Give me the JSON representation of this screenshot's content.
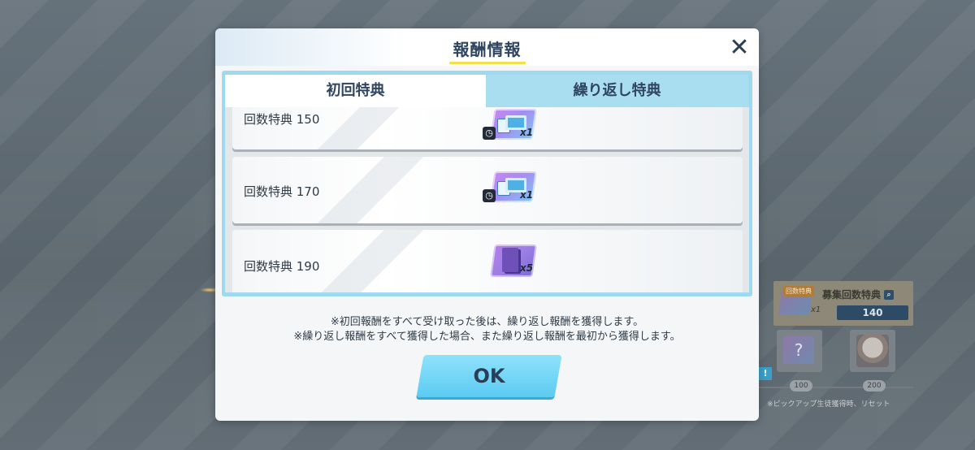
{
  "background": {
    "panel_tag": "回数特典",
    "panel_title": "募集回数特典",
    "panel_qty": "x1",
    "panel_count": "140",
    "slot_question": "?",
    "milestone_1": "100",
    "milestone_2": "200",
    "note": "※ピックアップ生徒獲得時、リセット",
    "exclaim": "!"
  },
  "modal": {
    "title": "報酬情報",
    "close_glyph": "✕",
    "tabs": [
      {
        "label": "初回特典",
        "active": true
      },
      {
        "label": "繰り返し特典",
        "active": false
      }
    ],
    "rewards": [
      {
        "label": "回数特典 150",
        "item": "ticket",
        "qty": "x1"
      },
      {
        "label": "回数特典 170",
        "item": "ticket",
        "qty": "x1"
      },
      {
        "label": "回数特典 190",
        "item": "pack",
        "qty": "x5"
      }
    ],
    "notice_line_1": "※初回報酬をすべて受け取った後は、繰り返し報酬を獲得します。",
    "notice_line_2": "※繰り返し報酬をすべて獲得した場合、また繰り返し報酬を最初から獲得します。",
    "ok_label": "OK"
  },
  "colors": {
    "title": "#2f4560",
    "title_underline": "#f2df4a",
    "tab_bar": "#9ed9ef",
    "ok_button": "#5ccbf2"
  }
}
